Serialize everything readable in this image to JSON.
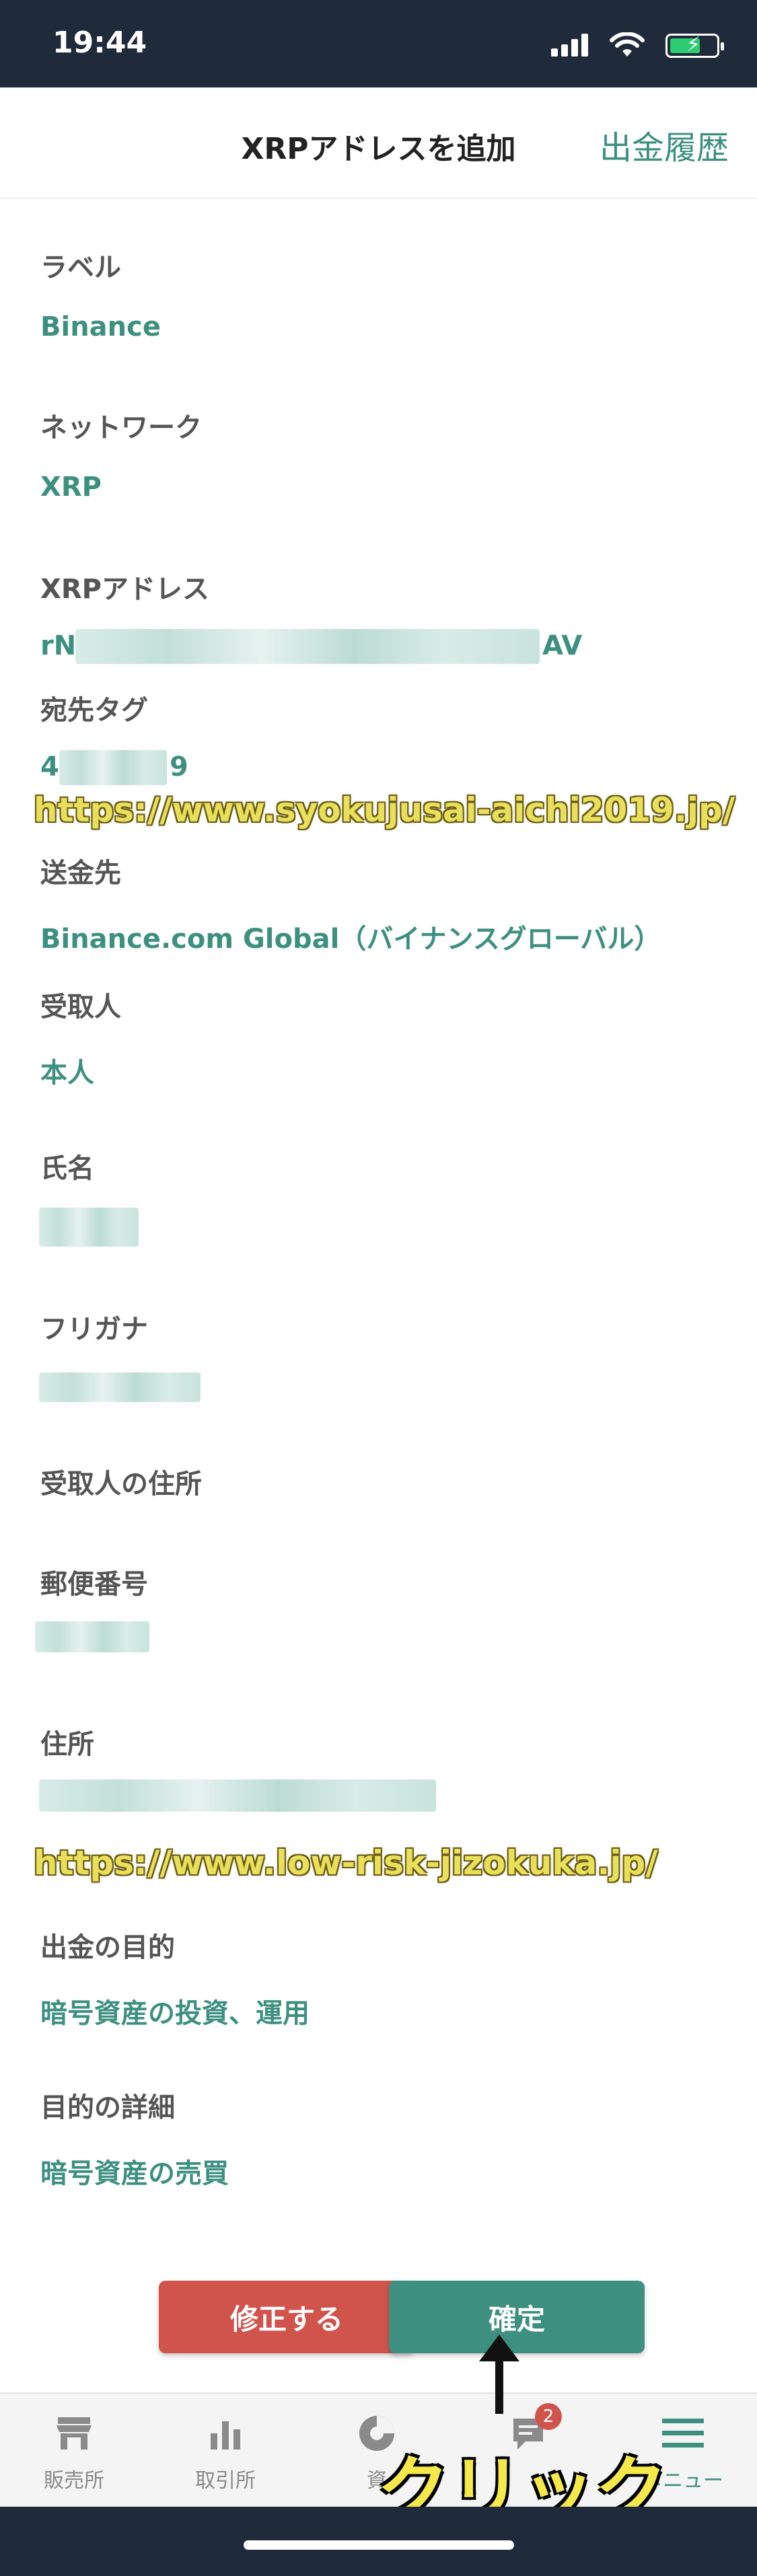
{
  "status_bar": {
    "time": "19:44"
  },
  "header": {
    "title": "XRPアドレスを追加",
    "history_link": "出金履歴"
  },
  "fields": {
    "label": {
      "label": "ラベル",
      "value": "Binance"
    },
    "network": {
      "label": "ネットワーク",
      "value": "XRP"
    },
    "address": {
      "label": "XRPアドレス",
      "value_prefix": "rN",
      "value_suffix": "AV"
    },
    "tag": {
      "label": "宛先タグ",
      "value_prefix": "4",
      "value_suffix": "9"
    },
    "destination": {
      "label": "送金先",
      "value": "Binance.com Global（バイナンスグローバル）"
    },
    "recipient": {
      "label": "受取人",
      "value": "本人"
    },
    "name": {
      "label": "氏名"
    },
    "furigana": {
      "label": "フリガナ"
    },
    "recipient_address": {
      "label": "受取人の住所"
    },
    "postal_code": {
      "label": "郵便番号"
    },
    "address_line": {
      "label": "住所"
    },
    "purpose": {
      "label": "出金の目的",
      "value": "暗号資産の投資、運用"
    },
    "purpose_detail": {
      "label": "目的の詳細",
      "value": "暗号資産の売買"
    }
  },
  "watermarks": {
    "top": "https://www.syokujusai-aichi2019.jp/",
    "bottom": "https://www.low-risk-jizokuka.jp/"
  },
  "buttons": {
    "edit": "修正する",
    "confirm": "確定"
  },
  "annotation": {
    "click": "クリック"
  },
  "tabbar": {
    "items": [
      {
        "label": "販売所",
        "icon": "store-icon"
      },
      {
        "label": "取引所",
        "icon": "bar-chart-icon"
      },
      {
        "label": "資",
        "icon": "pie-chart-icon"
      },
      {
        "label": "",
        "icon": "notice-icon",
        "badge": "2"
      },
      {
        "label": "メニュー",
        "icon": "menu-icon"
      }
    ]
  },
  "colors": {
    "accent": "#3d9080",
    "danger": "#d0544b",
    "statusbar": "#1f2a3a"
  }
}
